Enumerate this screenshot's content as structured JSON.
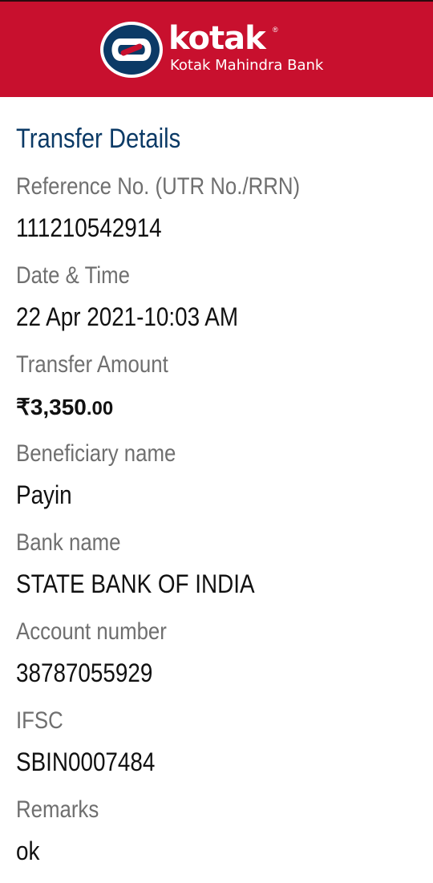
{
  "header": {
    "brand_name": "kotak",
    "registered_mark": "®",
    "bank_name": "Kotak Mahindra Bank",
    "logo_icon": "kotak-logo-icon",
    "colors": {
      "background": "#c8102e",
      "logo_circle": "#0b3a66",
      "text": "#ffffff"
    }
  },
  "transfer_details": {
    "title": "Transfer Details",
    "reference": {
      "label": "Reference No. (UTR No./RRN)",
      "value": "111210542914"
    },
    "date_time": {
      "label": "Date & Time",
      "value": "22 Apr 2021-10:03 AM"
    },
    "amount": {
      "label": "Transfer Amount",
      "value_main": "₹3,350",
      "value_decimal": ".00"
    },
    "beneficiary_name": {
      "label": "Beneficiary name",
      "value": "Payin"
    },
    "bank_name": {
      "label": "Bank name",
      "value": "STATE BANK OF INDIA"
    },
    "account_number": {
      "label": "Account number",
      "value": "38787055929"
    },
    "ifsc": {
      "label": "IFSC",
      "value": "SBIN0007484"
    },
    "remarks": {
      "label": "Remarks",
      "value": "ok"
    }
  }
}
